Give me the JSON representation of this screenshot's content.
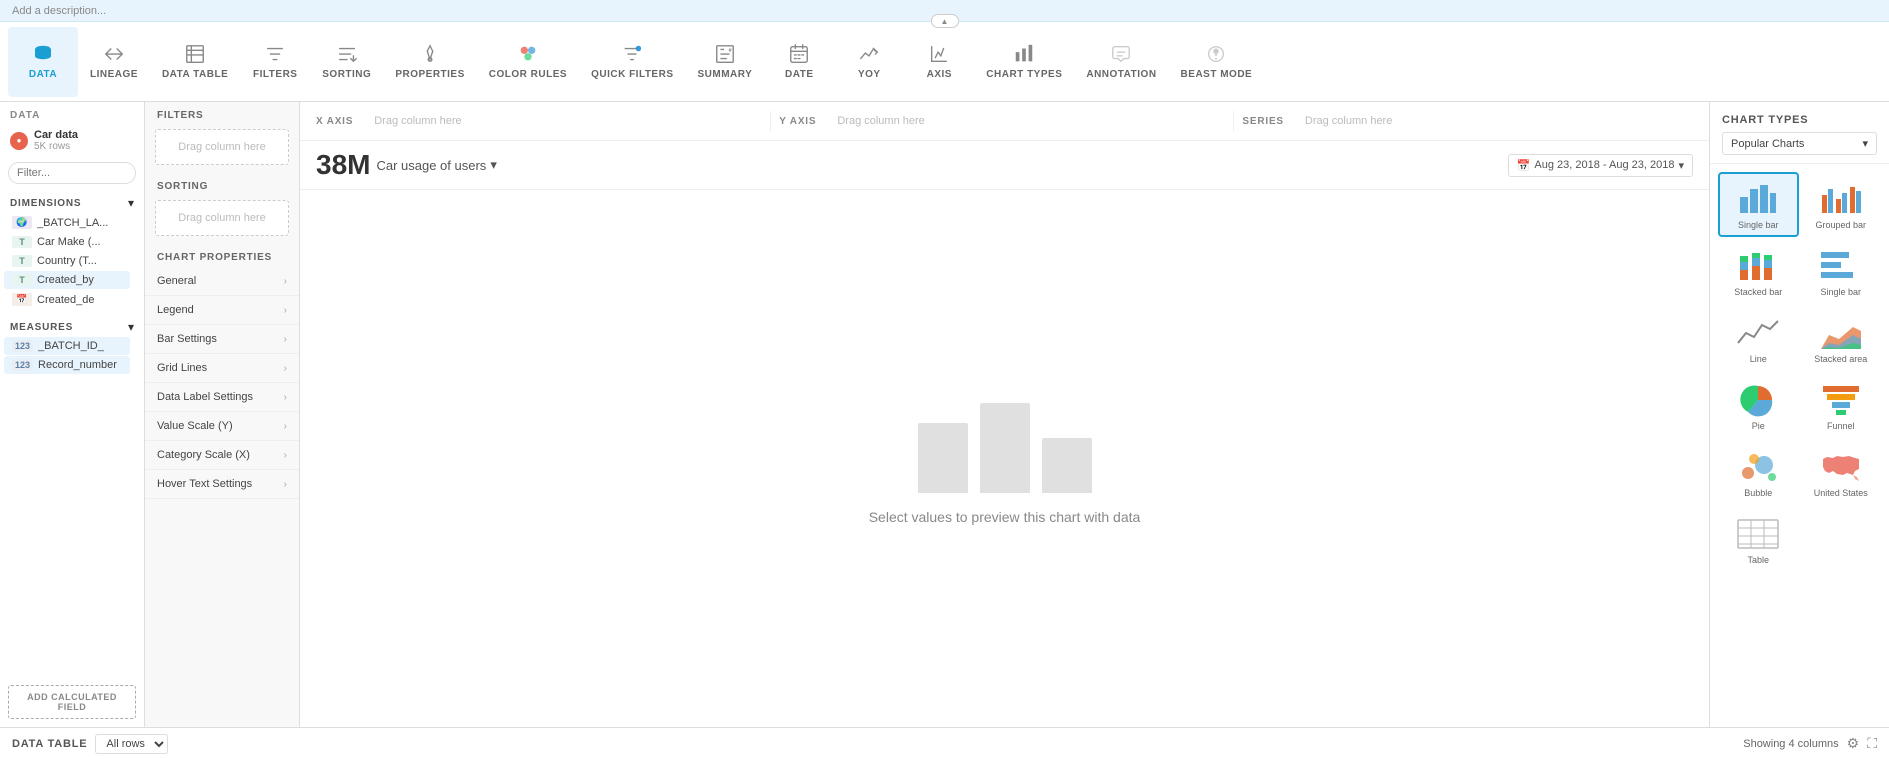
{
  "app": {
    "desc_placeholder": "Add a description..."
  },
  "toolbar": {
    "items": [
      {
        "id": "data",
        "label": "DATA",
        "active": true
      },
      {
        "id": "lineage",
        "label": "LINEAGE",
        "active": false
      },
      {
        "id": "data-table",
        "label": "DATA TABLE",
        "active": false
      },
      {
        "id": "filters",
        "label": "FILTERS",
        "active": false
      },
      {
        "id": "sorting",
        "label": "SORTING",
        "active": false
      },
      {
        "id": "properties",
        "label": "PROPERTIES",
        "active": false
      },
      {
        "id": "color-rules",
        "label": "COLOR RULES",
        "active": false
      },
      {
        "id": "quick-filters",
        "label": "QUICK FILTERS",
        "active": false
      },
      {
        "id": "summary",
        "label": "SUMMARY",
        "active": false
      },
      {
        "id": "date",
        "label": "DATE",
        "active": false
      },
      {
        "id": "yoy",
        "label": "YOY",
        "active": false
      },
      {
        "id": "axis",
        "label": "AXIS",
        "active": false
      },
      {
        "id": "chart-types",
        "label": "CHART TYPES",
        "active": false
      },
      {
        "id": "annotation",
        "label": "ANNOTATION",
        "active": false
      },
      {
        "id": "beast-mode",
        "label": "BEAST MODE",
        "active": false
      }
    ]
  },
  "sidebar": {
    "section_title": "DATA",
    "data_source": {
      "name": "Car data",
      "rows": "5K rows"
    },
    "filter_placeholder": "Filter...",
    "dimensions": {
      "title": "DIMENSIONS",
      "items": [
        {
          "type": "geo",
          "label": "_BATCH_LA...",
          "active": false
        },
        {
          "type": "T",
          "label": "Car Make (...",
          "active": false
        },
        {
          "type": "T",
          "label": "Country (T...",
          "active": false
        },
        {
          "type": "T",
          "label": "Created_by",
          "active": false
        },
        {
          "type": "date",
          "label": "Created_de",
          "active": false
        }
      ]
    },
    "measures": {
      "title": "MEASURES",
      "items": [
        {
          "type": "num",
          "label": "_BATCH_ID_",
          "active": false
        },
        {
          "type": "num",
          "label": "Record_number",
          "active": false
        }
      ]
    },
    "add_calc_field": "ADD CALCULATED FIELD"
  },
  "filters_panel": {
    "title": "FILTERS",
    "drag_label": "Drag column here"
  },
  "sorting_panel": {
    "title": "SORTING",
    "drag_label": "Drag column here"
  },
  "chart_properties": {
    "title": "CHART PROPERTIES",
    "items": [
      {
        "label": "General"
      },
      {
        "label": "Legend"
      },
      {
        "label": "Bar Settings"
      },
      {
        "label": "Grid Lines"
      },
      {
        "label": "Data Label Settings"
      },
      {
        "label": "Value Scale (Y)"
      },
      {
        "label": "Category Scale (X)"
      },
      {
        "label": "Hover Text Settings"
      }
    ]
  },
  "axis": {
    "x_label": "X AXIS",
    "x_placeholder": "Drag column here",
    "y_label": "Y AXIS",
    "y_placeholder": "Drag column here",
    "series_label": "SERIES",
    "series_placeholder": "Drag column here"
  },
  "chart": {
    "count": "38M",
    "subtitle": "Car usage of users",
    "date_range": "Aug 23, 2018 - Aug 23, 2018",
    "placeholder_text": "Select values to preview",
    "placeholder_text2": "this chart with data"
  },
  "right_panel": {
    "title": "CHART TYPES",
    "dropdown_label": "Popular Charts",
    "chart_types": [
      {
        "id": "single-bar",
        "label": "Single bar",
        "selected": true
      },
      {
        "id": "grouped-bar",
        "label": "Grouped bar",
        "selected": false
      },
      {
        "id": "stacked-bar",
        "label": "Stacked bar",
        "selected": false
      },
      {
        "id": "single-bar-h",
        "label": "Single bar",
        "selected": false
      },
      {
        "id": "line",
        "label": "Line",
        "selected": false
      },
      {
        "id": "stacked-area",
        "label": "Stacked area",
        "selected": false
      },
      {
        "id": "pie",
        "label": "Pie",
        "selected": false
      },
      {
        "id": "funnel",
        "label": "Funnel",
        "selected": false
      },
      {
        "id": "bubble",
        "label": "Bubble",
        "selected": false
      },
      {
        "id": "united-states",
        "label": "United States",
        "selected": false
      },
      {
        "id": "table",
        "label": "Table",
        "selected": false
      }
    ]
  },
  "bottom_bar": {
    "table_label": "DATA TABLE",
    "row_option": "All rows",
    "showing_text": "Showing 4 columns"
  }
}
